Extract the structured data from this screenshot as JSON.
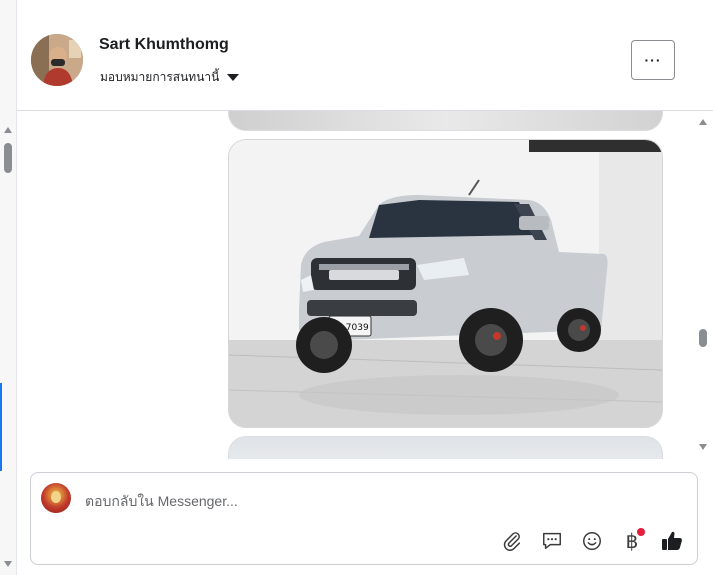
{
  "header": {
    "name": "Sart Khumthomg",
    "assign_label": "มอบหมายการสนทนานี้",
    "more_label": "···"
  },
  "composer": {
    "placeholder": "ตอบกลับใน Messenger...",
    "currency_symbol": "฿"
  },
  "photo": {
    "plate_text": "ษบ 7039"
  },
  "icons": {
    "attach": "paperclip-icon",
    "saved_replies": "chat-bubble-icon",
    "emoji": "smiley-icon",
    "payment": "baht-icon",
    "like": "thumbs-up-icon"
  },
  "colors": {
    "accent": "#1877f2",
    "notification": "#e41e3f"
  }
}
